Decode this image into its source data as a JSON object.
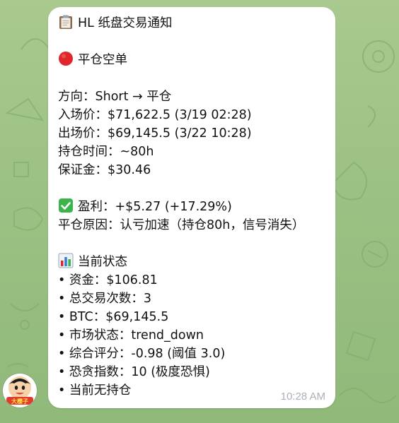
{
  "message": {
    "title": "HL 纸盘交易通知",
    "action": "平仓空单",
    "details": [
      "方向：Short → 平仓",
      "入场价：$71,622.5  (3/19 02:28)",
      "出场价：$69,145.5  (3/22 10:28)",
      "持仓时间：~80h",
      "保证金：$30.46"
    ],
    "profit": "盈利：+$5.27  (+17.29%)",
    "close_reason": "平仓原因：认亏加速（持仓80h，信号消失）",
    "status_header": "当前状态",
    "status_items": [
      "• 资金：$106.81",
      "• 总交易次数：3",
      "• BTC：$69,145.5",
      "• 市场状态：trend_down",
      "• 综合评分：-0.98  (阈值 3.0)",
      "• 恐贪指数：10  (极度恐惧)",
      "• 当前无持仓"
    ],
    "time": "10:28 AM"
  },
  "avatar": {
    "label": "大樱子"
  },
  "icons": {
    "clipboard": "clipboard-icon",
    "red_circle": "red-circle-icon",
    "check": "check-mark-icon",
    "chart": "bar-chart-icon"
  },
  "colors": {
    "background": "#9cc184",
    "bubble": "#ffffff",
    "timestamp": "#a8b0b8",
    "red_circle": "#e0262a",
    "check": "#3bb54a"
  }
}
